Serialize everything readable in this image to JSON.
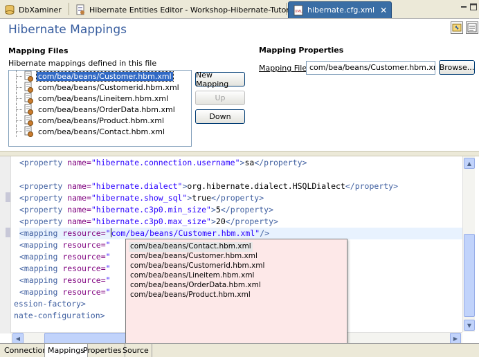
{
  "tabs": [
    {
      "label": "DbXaminer",
      "icon": "db-icon"
    },
    {
      "label": "Hibernate Entities Editor - Workshop-Hibernate-Tutorial",
      "icon": "hibernate-icon"
    },
    {
      "label": "hibernate.cfg.xml",
      "icon": "xml-file-icon",
      "close": "✕"
    }
  ],
  "header": {
    "title": "Hibernate Mappings"
  },
  "mapping_files": {
    "heading": "Mapping Files",
    "description": "Hibernate mappings defined in this file",
    "items": [
      "com/bea/beans/Customer.hbm.xml",
      "com/bea/beans/Customerid.hbm.xml",
      "com/bea/beans/Lineitem.hbm.xml",
      "com/bea/beans/OrderData.hbm.xml",
      "com/bea/beans/Product.hbm.xml",
      "com/bea/beans/Contact.hbm.xml"
    ],
    "buttons": {
      "new": "New Mapping",
      "up": "Up",
      "down": "Down"
    }
  },
  "mapping_properties": {
    "heading": "Mapping Properties",
    "file_label": "Mapping File:",
    "file_value": "com/bea/beans/Customer.hbm.xml",
    "browse": "Browse..."
  },
  "source": {
    "lines": [
      {
        "parts": [
          [
            "tag",
            "<property "
          ],
          [
            "attr",
            "name="
          ],
          [
            "str",
            "\"hibernate.connection.username\""
          ],
          [
            "tag",
            ">"
          ],
          [
            "txt",
            "sa"
          ],
          [
            "tag",
            "</property>"
          ]
        ]
      },
      {
        "parts": []
      },
      {
        "parts": [
          [
            "tag",
            "<property "
          ],
          [
            "attr",
            "name="
          ],
          [
            "str",
            "\"hibernate.dialect\""
          ],
          [
            "tag",
            ">"
          ],
          [
            "txt",
            "org.hibernate.dialect.HSQLDialect"
          ],
          [
            "tag",
            "</property>"
          ]
        ]
      },
      {
        "parts": [
          [
            "tag",
            "<property "
          ],
          [
            "attr",
            "name="
          ],
          [
            "str",
            "\"hibernate.show_sql\""
          ],
          [
            "tag",
            ">"
          ],
          [
            "txt",
            "true"
          ],
          [
            "tag",
            "</property>"
          ]
        ]
      },
      {
        "parts": [
          [
            "tag",
            "<property "
          ],
          [
            "attr",
            "name="
          ],
          [
            "str",
            "\"hibernate.c3p0.min_size\""
          ],
          [
            "tag",
            ">"
          ],
          [
            "txt",
            "5"
          ],
          [
            "tag",
            "</property>"
          ]
        ]
      },
      {
        "parts": [
          [
            "tag",
            "<property "
          ],
          [
            "attr",
            "name="
          ],
          [
            "str",
            "\"hibernate.c3p0.max_size\""
          ],
          [
            "tag",
            ">"
          ],
          [
            "txt",
            "20"
          ],
          [
            "tag",
            "</property>"
          ]
        ]
      },
      {
        "parts": [
          [
            "tag",
            "<mapping "
          ],
          [
            "attr",
            "resource="
          ],
          [
            "str",
            "\""
          ],
          [
            "cursor",
            ""
          ],
          [
            "str",
            "com/bea/beans/Customer.hbm.xml\""
          ],
          [
            "tag",
            "/>"
          ]
        ]
      },
      {
        "parts": [
          [
            "tag",
            "<mapping "
          ],
          [
            "attr",
            "resource="
          ],
          [
            "str",
            "\""
          ]
        ]
      },
      {
        "parts": [
          [
            "tag",
            "<mapping "
          ],
          [
            "attr",
            "resource="
          ],
          [
            "str",
            "\""
          ]
        ]
      },
      {
        "parts": [
          [
            "tag",
            "<mapping "
          ],
          [
            "attr",
            "resource="
          ],
          [
            "str",
            "\""
          ]
        ]
      },
      {
        "parts": [
          [
            "tag",
            "<mapping "
          ],
          [
            "attr",
            "resource="
          ],
          [
            "str",
            "\""
          ]
        ]
      },
      {
        "parts": [
          [
            "tag",
            "<mapping "
          ],
          [
            "attr",
            "resource="
          ],
          [
            "str",
            "\""
          ]
        ]
      },
      {
        "parts": [
          [
            "tag",
            "ession-factory>"
          ]
        ]
      },
      {
        "parts": [
          [
            "tag",
            "nate-configuration>"
          ]
        ]
      }
    ]
  },
  "content_assist": {
    "items": [
      "com/bea/beans/Contact.hbm.xml",
      "com/bea/beans/Customer.hbm.xml",
      "com/bea/beans/Customerid.hbm.xml",
      "com/bea/beans/Lineitem.hbm.xml",
      "com/bea/beans/OrderData.hbm.xml",
      "com/bea/beans/Product.hbm.xml"
    ]
  },
  "page_tabs": [
    "Connection",
    "Mappings",
    "Properties",
    "Source"
  ],
  "colors": {
    "title": "#3a5fa0",
    "selection": "#316ac5",
    "popup_bg": "#fde8e8"
  }
}
